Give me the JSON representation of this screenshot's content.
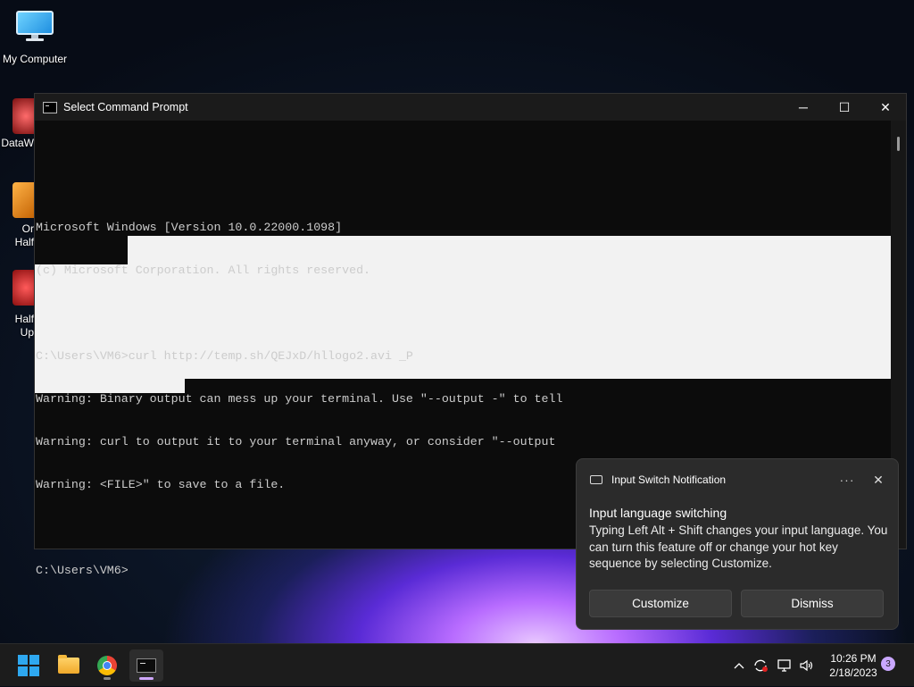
{
  "desktop": {
    "my_computer_label": "My Computer",
    "side_icons": [
      {
        "label": "DataW",
        "color": "#c43838"
      },
      {
        "label": "Or\nHalf",
        "color": "#e8861a"
      },
      {
        "label": "Half\nUp",
        "color": "#c81e1e"
      }
    ]
  },
  "cmd": {
    "title": "Select Command Prompt",
    "lines": [
      "Microsoft Windows [Version 10.0.22000.1098]",
      "(c) Microsoft Corporation. All rights reserved.",
      "",
      "C:\\Users\\VM6>curl http://temp.sh/QEJxD/hllogo2.avi _P",
      "Warning: Binary output can mess up your terminal. Use \"--output -\" to tell",
      "Warning: curl to output it to your terminal anyway, or consider \"--output",
      "Warning: <FILE>\" to save to a file.",
      "",
      "C:\\Users\\VM6>"
    ],
    "minimize": "─",
    "maximize": "☐",
    "close": "✕"
  },
  "notification": {
    "app_name": "Input Switch Notification",
    "more_glyph": "···",
    "close_glyph": "✕",
    "title": "Input language switching",
    "body": "Typing Left Alt + Shift changes your input language. You can turn this feature off or change your hot key sequence by selecting Customize.",
    "customize_label": "Customize",
    "dismiss_label": "Dismiss"
  },
  "taskbar": {
    "apps": [
      "start-icon",
      "file-explorer-icon",
      "chrome-icon",
      "terminal-icon"
    ],
    "tray_chevron": "^",
    "time": "10:26 PM",
    "date": "2/18/2023",
    "notification_count": "3"
  },
  "colors": {
    "accent": "#c9a7ff",
    "console_bg": "#0c0c0c",
    "selection": "#f2f2f2"
  }
}
